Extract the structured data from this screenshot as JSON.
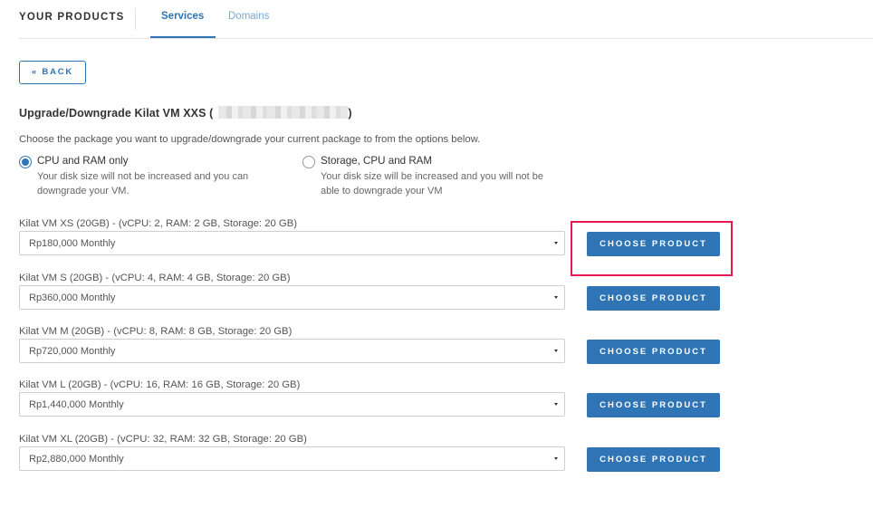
{
  "topnav": {
    "brand": "YOUR PRODUCTS",
    "tabs": [
      {
        "label": "Services",
        "active": true
      },
      {
        "label": "Domains",
        "active": false
      }
    ]
  },
  "back_button": "« BACK",
  "title": {
    "prefix": "Upgrade/Downgrade Kilat VM XXS (",
    "suffix": ")"
  },
  "intro": "Choose the package you want to upgrade/downgrade your current package to from the options below.",
  "options": [
    {
      "label": "CPU and RAM only",
      "description": "Your disk size will not be increased and you can downgrade your VM.",
      "selected": true
    },
    {
      "label": "Storage, CPU and RAM",
      "description": "Your disk size will be increased and you will not be able to downgrade your VM",
      "selected": false
    }
  ],
  "products": [
    {
      "label": "Kilat VM XS (20GB) - (vCPU: 2, RAM: 2 GB, Storage: 20 GB)",
      "price": "Rp180,000 Monthly",
      "button": "CHOOSE PRODUCT"
    },
    {
      "label": "Kilat VM S (20GB) - (vCPU: 4, RAM: 4 GB, Storage: 20 GB)",
      "price": "Rp360,000 Monthly",
      "button": "CHOOSE PRODUCT"
    },
    {
      "label": "Kilat VM M (20GB) - (vCPU: 8, RAM: 8 GB, Storage: 20 GB)",
      "price": "Rp720,000 Monthly",
      "button": "CHOOSE PRODUCT"
    },
    {
      "label": "Kilat VM L (20GB) - (vCPU: 16, RAM: 16 GB, Storage: 20 GB)",
      "price": "Rp1,440,000 Monthly",
      "button": "CHOOSE PRODUCT"
    },
    {
      "label": "Kilat VM XL (20GB) - (vCPU: 32, RAM: 32 GB, Storage: 20 GB)",
      "price": "Rp2,880,000 Monthly",
      "button": "CHOOSE PRODUCT"
    }
  ],
  "colors": {
    "accent": "#2f74b5",
    "highlight": "#e5194c"
  }
}
